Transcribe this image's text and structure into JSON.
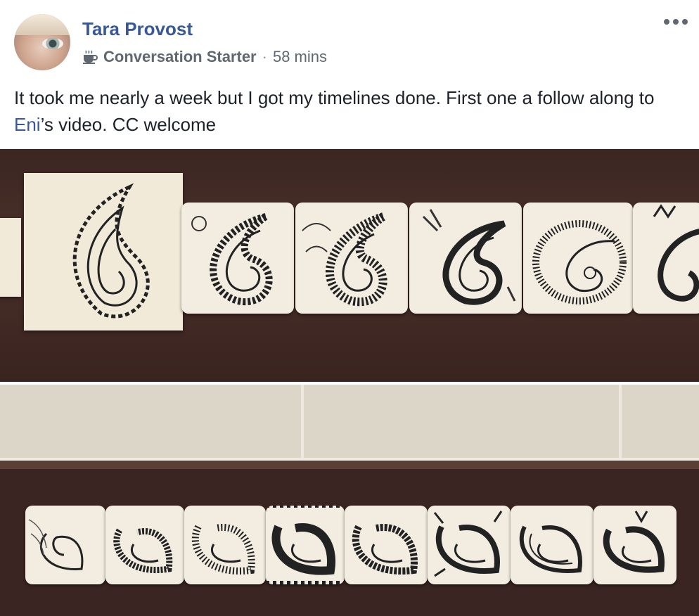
{
  "post": {
    "author": "Tara Provost",
    "badge_icon": "coffee-cup-icon",
    "badge": "Conversation Starter",
    "separator": "·",
    "time": "58 mins",
    "text_before": "It took me nearly a week but I got my timelines done. First one a follow along to ",
    "mention": "Eni",
    "text_after": "’s video. CC welcome",
    "more_icon": "more-options-icon"
  },
  "colors": {
    "name": "#385898",
    "meta": "#616770",
    "body_text": "#1d2129",
    "wood": "#3b2522",
    "paper": "#f2ece1"
  }
}
